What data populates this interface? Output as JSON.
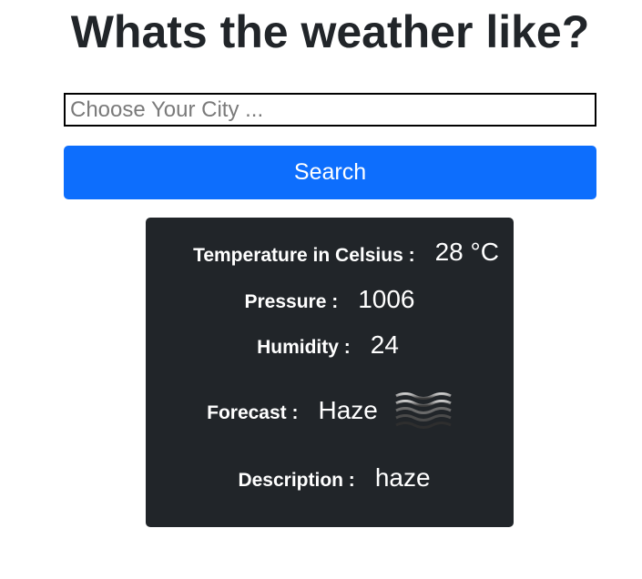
{
  "page": {
    "title": "Whats the weather like?"
  },
  "search": {
    "placeholder": "Choose Your City ...",
    "value": "",
    "button_label": "Search"
  },
  "weather": {
    "temperature_label": "Temperature in Celsius :",
    "temperature_value": "28 °C",
    "pressure_label": "Pressure :",
    "pressure_value": "1006",
    "humidity_label": "Humidity :",
    "humidity_value": "24",
    "forecast_label": "Forecast :",
    "forecast_value": "Haze",
    "forecast_icon": "haze-icon",
    "description_label": "Description :",
    "description_value": "haze"
  },
  "colors": {
    "primary_button": "#0d6efd",
    "card_background": "#212529",
    "title_text": "#212529"
  }
}
